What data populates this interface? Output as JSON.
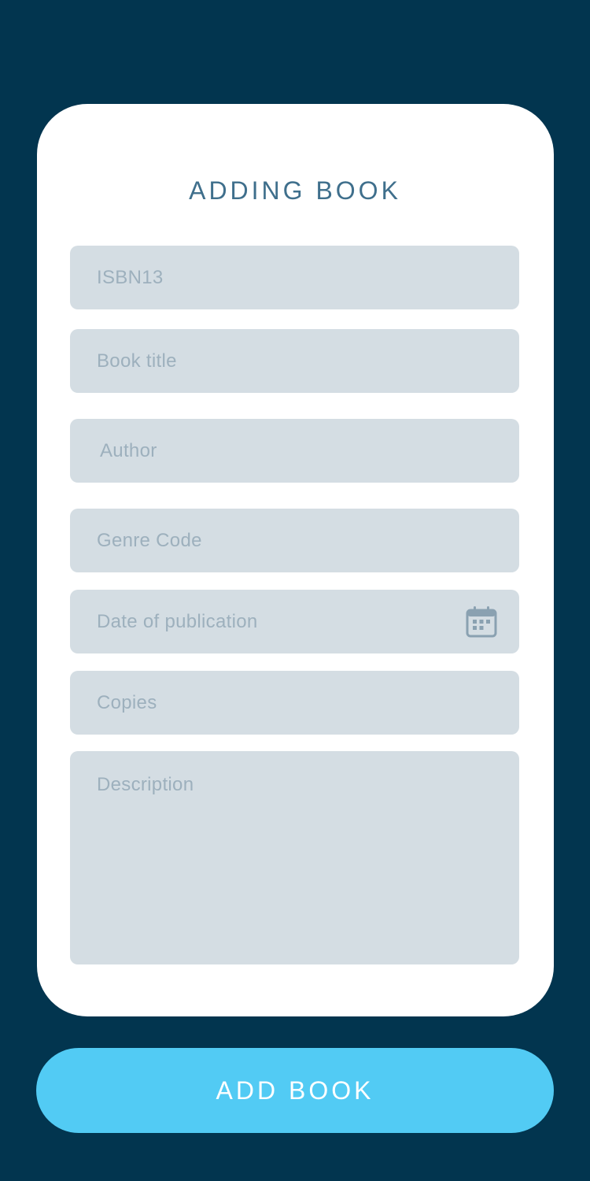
{
  "form": {
    "title": "ADDING BOOK",
    "fields": {
      "isbn": {
        "placeholder": "ISBN13"
      },
      "title": {
        "placeholder": "Book title"
      },
      "author": {
        "placeholder": "Author"
      },
      "genre": {
        "placeholder": "Genre Code"
      },
      "date": {
        "placeholder": "Date of publication",
        "icon": "calendar-icon"
      },
      "copies": {
        "placeholder": "Copies"
      },
      "description": {
        "placeholder": "Description"
      }
    },
    "submit_label": "ADD BOOK"
  },
  "colors": {
    "background": "#02354f",
    "card": "#ffffff",
    "field": "#d4dde3",
    "placeholder": "#9db0bd",
    "title": "#3f6f8c",
    "button": "#52cbf4",
    "button_text": "#ffffff"
  }
}
